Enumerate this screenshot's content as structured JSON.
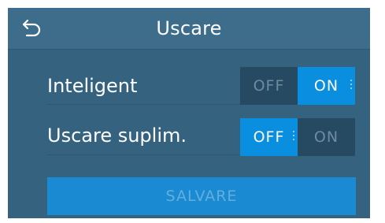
{
  "header": {
    "title": "Uscare",
    "back_icon": "back-arrow-icon"
  },
  "settings": [
    {
      "label": "Inteligent",
      "off_label": "OFF",
      "on_label": "ON",
      "state": "ON"
    },
    {
      "label": "Uscare suplim.",
      "off_label": "OFF",
      "on_label": "ON",
      "state": "OFF"
    }
  ],
  "save_button": {
    "label": "SALVARE",
    "enabled": false
  },
  "colors": {
    "background": "#35627f",
    "header": "#3d6d8a",
    "accent": "#0a8ee0",
    "toggle_inactive": "#264a61",
    "save_button": "#1a8ad3"
  }
}
